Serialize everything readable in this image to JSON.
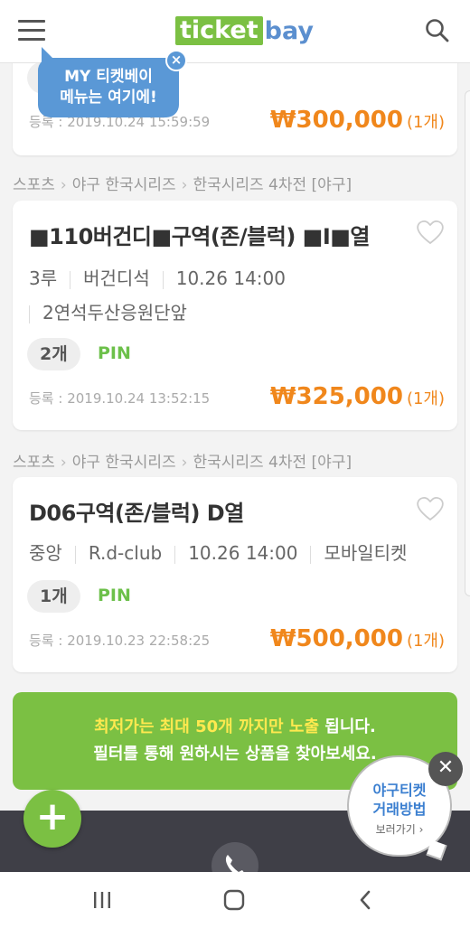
{
  "header": {
    "logo_part1": "ticket",
    "logo_part2": "bay"
  },
  "tooltip": {
    "line1": "MY 티켓베이",
    "line2": "메뉴는 여기에!",
    "close": "×"
  },
  "prev_listing": {
    "registered": "등록 : 2019.10.24 15:59:59",
    "price": "₩300,000",
    "count": "(1개)"
  },
  "listings": [
    {
      "breadcrumb": [
        "스포츠",
        "야구 한국시리즈",
        "한국시리즈 4차전 [야구]"
      ],
      "title": "■110버건디■구역(존/블럭) ■I■열",
      "info": [
        "3루",
        "버건디석",
        "10.26 14:00"
      ],
      "info2": "2연석두산응원단앞",
      "quantity": "2개",
      "pin": "PIN",
      "registered": "등록 : 2019.10.24 13:52:15",
      "price": "₩325,000",
      "count": "(1개)"
    },
    {
      "breadcrumb": [
        "스포츠",
        "야구 한국시리즈",
        "한국시리즈 4차전 [야구]"
      ],
      "title": "D06구역(존/블럭) D열",
      "info": [
        "중앙",
        "R.d-club",
        "10.26 14:00",
        "모바일티켓"
      ],
      "quantity": "1개",
      "pin": "PIN",
      "registered": "등록 : 2019.10.23 22:58:25",
      "price": "₩500,000",
      "count": "(1개)"
    }
  ],
  "notice": {
    "line1_highlight": "최저가는 최대 50개 까지만 노출",
    "line1_rest": " 됩니다.",
    "line2": "필터를 통해 원하시는 상품을 찾아보세요."
  },
  "fab": {
    "label": "+"
  },
  "guide_bubble": {
    "line1": "야구티켓",
    "line2": "거래방법",
    "line3": "보러가기 ›",
    "close": "✕"
  },
  "colors": {
    "brand_green": "#7bc043",
    "brand_blue": "#5b8fcf",
    "price_orange": "#f0871c",
    "pin_green": "#6cc04a",
    "highlight_yellow": "#ffe94f"
  },
  "icons": [
    "menu-icon",
    "search-icon",
    "heart-icon",
    "close-icon",
    "plus-icon",
    "phone-icon",
    "recent-apps-icon",
    "home-icon",
    "back-icon"
  ]
}
